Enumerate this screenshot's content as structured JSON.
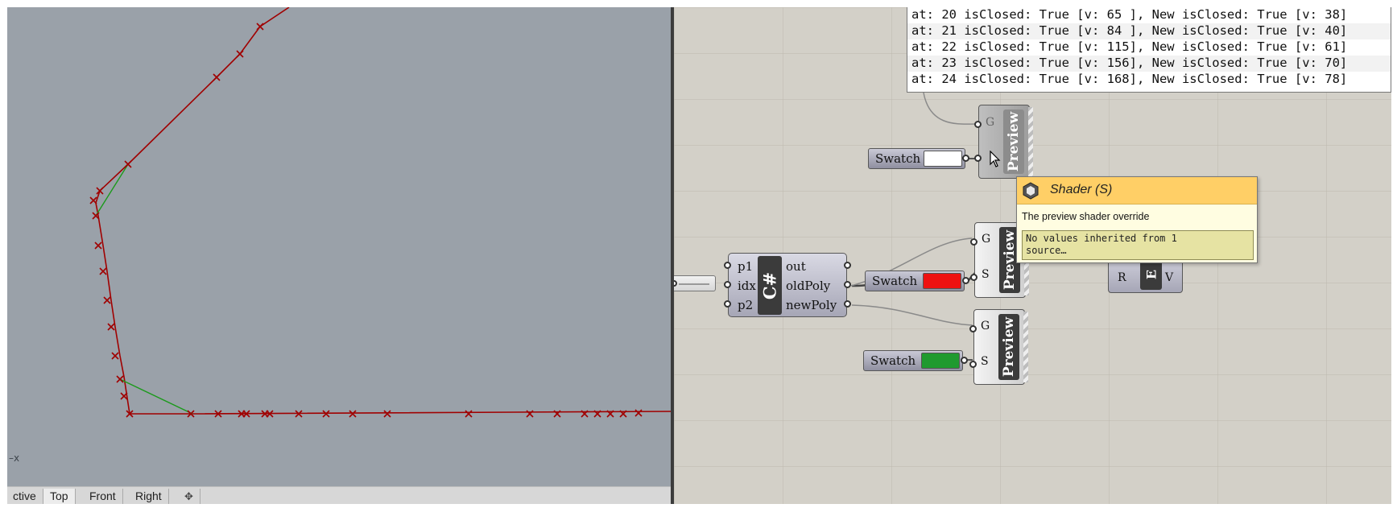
{
  "viewport": {
    "axis_label": "–x",
    "tabs": [
      "ctive",
      "Top",
      "Front",
      "Right"
    ],
    "active_tab": "Top",
    "add_tab_icon": "plus-icon",
    "colors": {
      "background": "#9aa1a9",
      "curve": "#a00000",
      "old_segment": "#1a9a1a"
    }
  },
  "panel": {
    "lines": [
      "at: 20 isClosed: True [v: 65 ], New isClosed: True [v: 38]",
      "at: 21 isClosed: True [v: 84 ], New isClosed: True [v: 40]",
      "at: 22 isClosed: True [v: 115], New isClosed: True [v: 61]",
      "at: 23 isClosed: True [v: 156], New isClosed: True [v: 70]",
      "at: 24 isClosed: True [v: 168], New isClosed: True [v: 78]"
    ]
  },
  "components": {
    "swatch_label": "Swatch",
    "swatch_colors": {
      "white": "#ffffff",
      "red": "#ee1111",
      "green": "#1f9a2f"
    },
    "preview_label": "Preview",
    "preview_inputs": {
      "geometry": "G",
      "shader": "S"
    },
    "csharp": {
      "title": "C#",
      "inputs": [
        "p1",
        "idx",
        "p2"
      ],
      "outputs": [
        "out",
        "oldPoly",
        "newPoly"
      ]
    },
    "expression": {
      "title": "E",
      "input": "R",
      "output": "V"
    }
  },
  "tooltip": {
    "icon": "hexagon-param-icon",
    "title": "Shader (S)",
    "description": "The preview shader override",
    "note_line1": "No values inherited from 1",
    "note_line2": "source…"
  }
}
